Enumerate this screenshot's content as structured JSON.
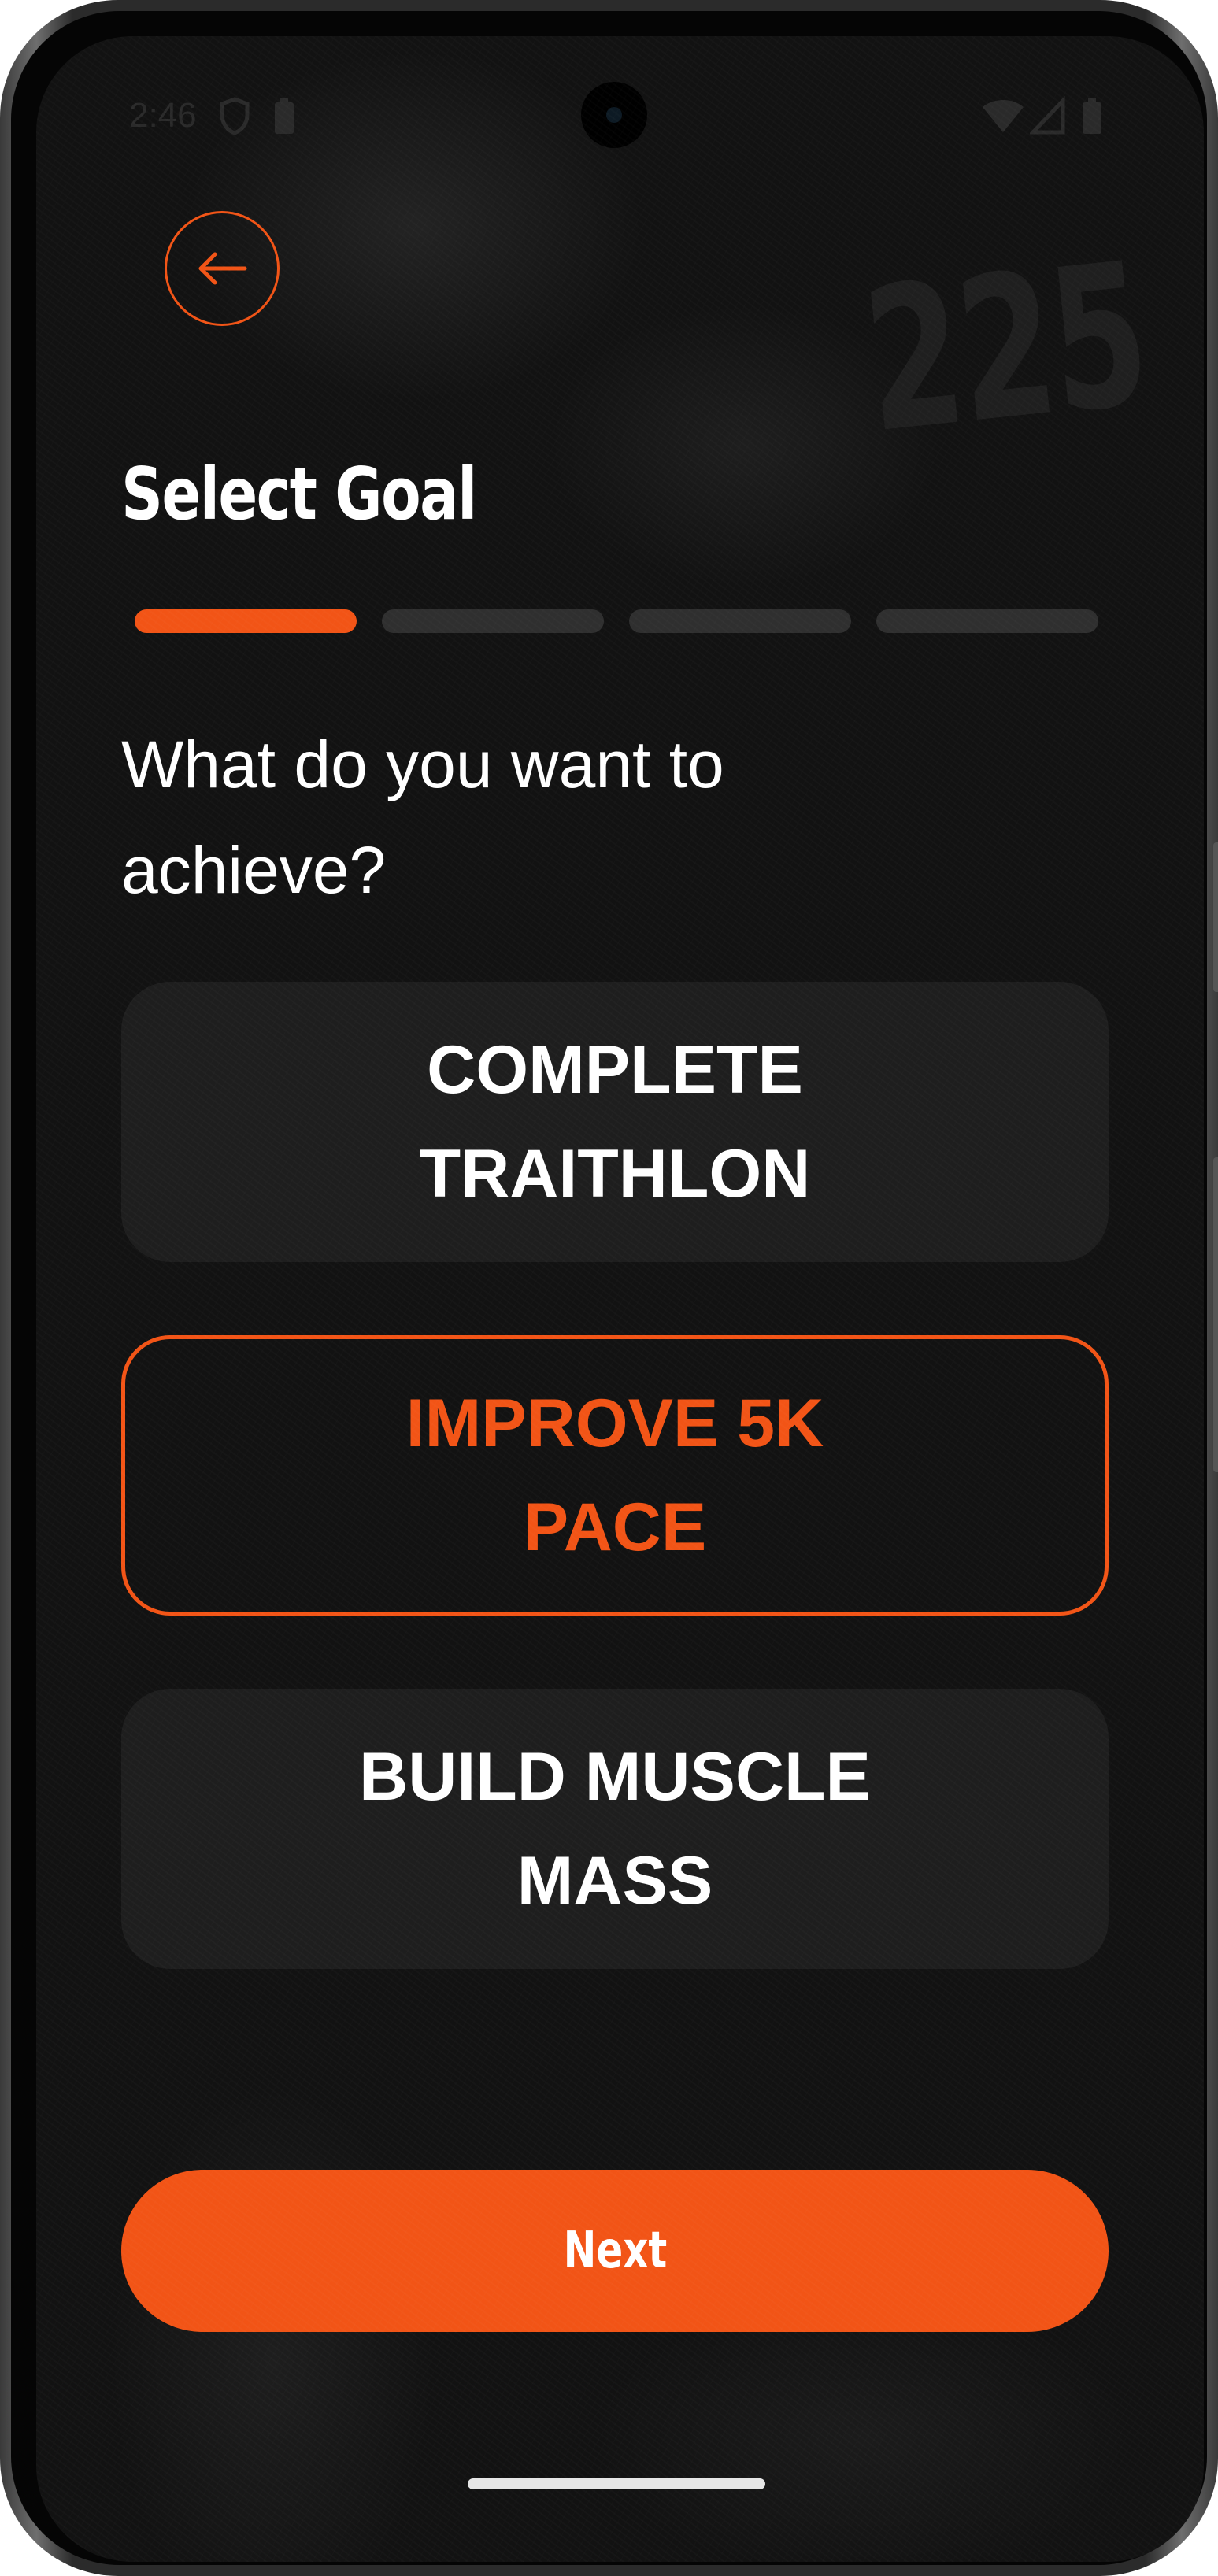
{
  "status_bar": {
    "time": "2:46",
    "left_icons": [
      "shield-icon",
      "battery-saver-icon"
    ],
    "right_icons": [
      "wifi-icon",
      "signal-icon",
      "battery-icon"
    ]
  },
  "header": {
    "back_icon": "arrow-left-icon",
    "title": "Select Goal",
    "watermark": "225"
  },
  "progress": {
    "total_steps": 4,
    "current_step": 1
  },
  "question": "What do you want to achieve?",
  "options": [
    {
      "label": "COMPLETE TRAITHLON",
      "selected": false
    },
    {
      "label": "IMPROVE 5K PACE",
      "selected": true
    },
    {
      "label": "BUILD MUSCLE MASS",
      "selected": false
    }
  ],
  "next_button": {
    "label": "Next"
  },
  "colors": {
    "accent": "#f25416",
    "background": "#121212",
    "card": "#1e1e1e",
    "text": "#ffffff"
  }
}
